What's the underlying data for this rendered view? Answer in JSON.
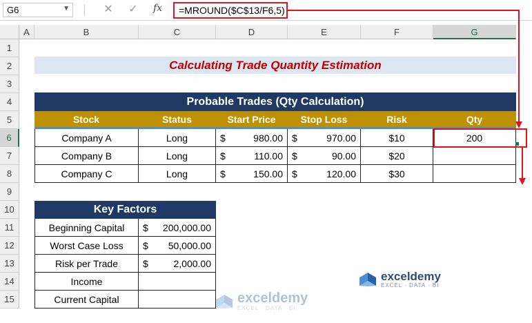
{
  "formula_bar": {
    "name_box": "G6",
    "cancel_icon": "✕",
    "enter_icon": "✓",
    "fx_label": "fx",
    "formula": "=MROUND($C$13/F6,5)"
  },
  "columns": [
    "A",
    "B",
    "C",
    "D",
    "E",
    "F",
    "G"
  ],
  "rows": [
    "1",
    "2",
    "3",
    "4",
    "5",
    "6",
    "7",
    "8",
    "9",
    "10",
    "11",
    "12",
    "13",
    "14",
    "15"
  ],
  "selected_cell": "G6",
  "title": "Calculating Trade Quantity Estimation",
  "trades_table": {
    "title": "Probable Trades (Qty Calculation)",
    "headers": [
      "Stock",
      "Status",
      "Start Price",
      "Stop Loss",
      "Risk",
      "Qty"
    ],
    "rows": [
      {
        "stock": "Company A",
        "status": "Long",
        "start_cur": "$",
        "start": "980.00",
        "stop_cur": "$",
        "stop": "970.00",
        "risk": "$10",
        "qty": "200"
      },
      {
        "stock": "Company B",
        "status": "Long",
        "start_cur": "$",
        "start": "110.00",
        "stop_cur": "$",
        "stop": "90.00",
        "risk": "$20",
        "qty": ""
      },
      {
        "stock": "Company C",
        "status": "Long",
        "start_cur": "$",
        "start": "150.00",
        "stop_cur": "$",
        "stop": "120.00",
        "risk": "$30",
        "qty": ""
      }
    ]
  },
  "key_factors": {
    "title": "Key Factors",
    "rows": [
      {
        "label": "Beginning Capital",
        "cur": "$",
        "value": "200,000.00"
      },
      {
        "label": "Worst Case Loss",
        "cur": "$",
        "value": "50,000.00"
      },
      {
        "label": "Risk per Trade",
        "cur": "$",
        "value": "2,000.00"
      },
      {
        "label": "Income",
        "cur": "",
        "value": ""
      },
      {
        "label": "Current Capital",
        "cur": "",
        "value": ""
      }
    ]
  },
  "watermark": {
    "brand": "exceldemy",
    "tagline": "EXCEL · DATA · BI"
  },
  "colors": {
    "navy": "#203864",
    "gold": "#bf9000",
    "title_red": "#c00000",
    "title_bg": "#dce6f1",
    "highlight_red": "#e2141b",
    "excel_green": "#217346"
  }
}
